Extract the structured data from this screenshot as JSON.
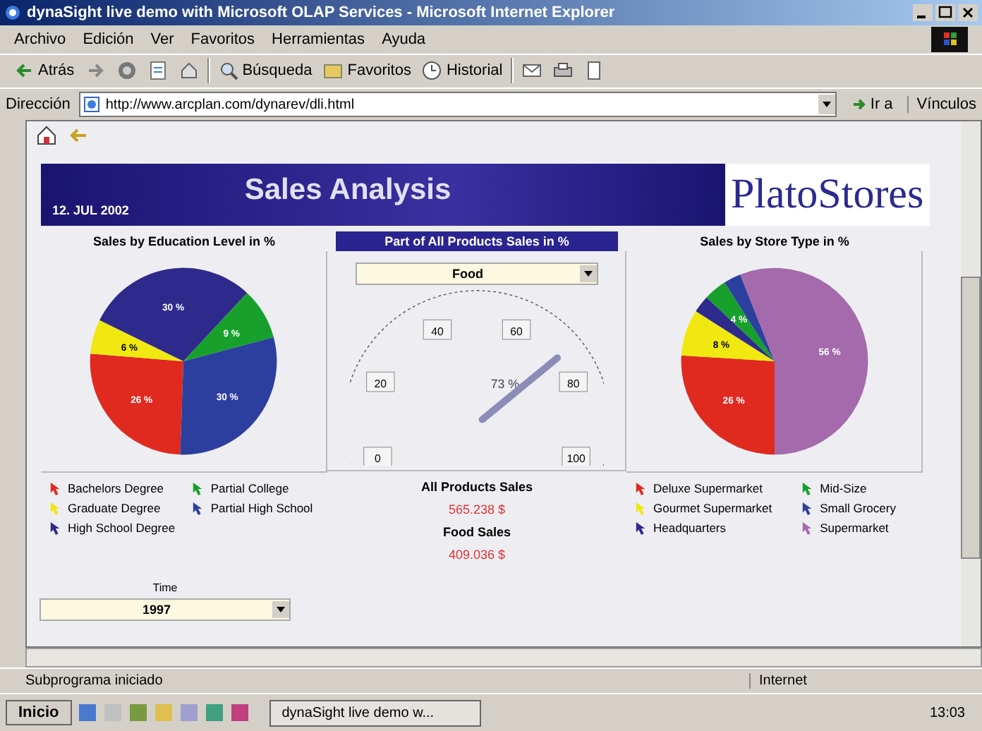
{
  "window": {
    "title": "dynaSight live demo with Microsoft OLAP Services - Microsoft Internet Explorer"
  },
  "menu": [
    "Archivo",
    "Edición",
    "Ver",
    "Favoritos",
    "Herramientas",
    "Ayuda"
  ],
  "toolbar": [
    {
      "kind": "back",
      "label": "Atrás"
    },
    {
      "kind": "forward"
    },
    {
      "kind": "stop"
    },
    {
      "kind": "refresh"
    },
    {
      "kind": "home"
    },
    {
      "kind": "search",
      "label": "Búsqueda"
    },
    {
      "kind": "favorites",
      "label": "Favoritos"
    },
    {
      "kind": "history",
      "label": "Historial"
    },
    {
      "kind": "mail"
    },
    {
      "kind": "print"
    },
    {
      "kind": "edit"
    }
  ],
  "address": {
    "label": "Dirección",
    "value": "http://www.arcplan.com/dynarev/dli.html",
    "go": "Ir a",
    "links": "Vínculos"
  },
  "dashboard": {
    "date": "12. JUL 2002",
    "title": "Sales Analysis",
    "logo": "PlatoStores",
    "education": {
      "chart_data": {
        "type": "pie",
        "title": "Sales by Education Level in %",
        "categories": [
          "Bachelors Degree",
          "Graduate Degree",
          "High School Degree",
          "Partial College",
          "Partial High School"
        ],
        "colors": [
          "#e02a20",
          "#f0e810",
          "#2e2a8c",
          "#17a02c",
          "#2d3f9e"
        ],
        "values": [
          26,
          6,
          30,
          9,
          30
        ],
        "value_labels": [
          "26 %",
          "6 %",
          "30 %",
          "9 %",
          "30 %"
        ]
      }
    },
    "gauge": {
      "title": "Part of All Products Sales in %",
      "product": "Food",
      "ticks": [
        "0",
        "20",
        "40",
        "60",
        "80",
        "100"
      ],
      "reading": "73 %"
    },
    "totals": [
      {
        "label": "All Products Sales",
        "value": "565.238 $"
      },
      {
        "label": "Food Sales",
        "value": "409.036 $"
      }
    ],
    "store": {
      "chart_data": {
        "type": "pie",
        "title": "Sales by Store Type in %",
        "categories": [
          "Deluxe Supermarket",
          "Gourmet Supermarket",
          "Headquarters",
          "Mid-Size",
          "Small Grocery",
          "Supermarket"
        ],
        "colors": [
          "#e02a20",
          "#f0e810",
          "#2e2a8c",
          "#17a02c",
          "#2d3f9e",
          "#a46aac"
        ],
        "values": [
          26,
          8,
          3,
          4,
          3,
          56
        ],
        "value_labels": [
          "26 %",
          "8 %",
          null,
          "4 %",
          null,
          "56 %"
        ]
      }
    },
    "time": {
      "label": "Time",
      "value": "1997"
    }
  },
  "status_bar": {
    "text": "Subprograma iniciado",
    "zone": "Internet"
  },
  "taskbar": {
    "start": "Inicio",
    "task": "dynaSight live demo w...",
    "clock": "13:03"
  }
}
